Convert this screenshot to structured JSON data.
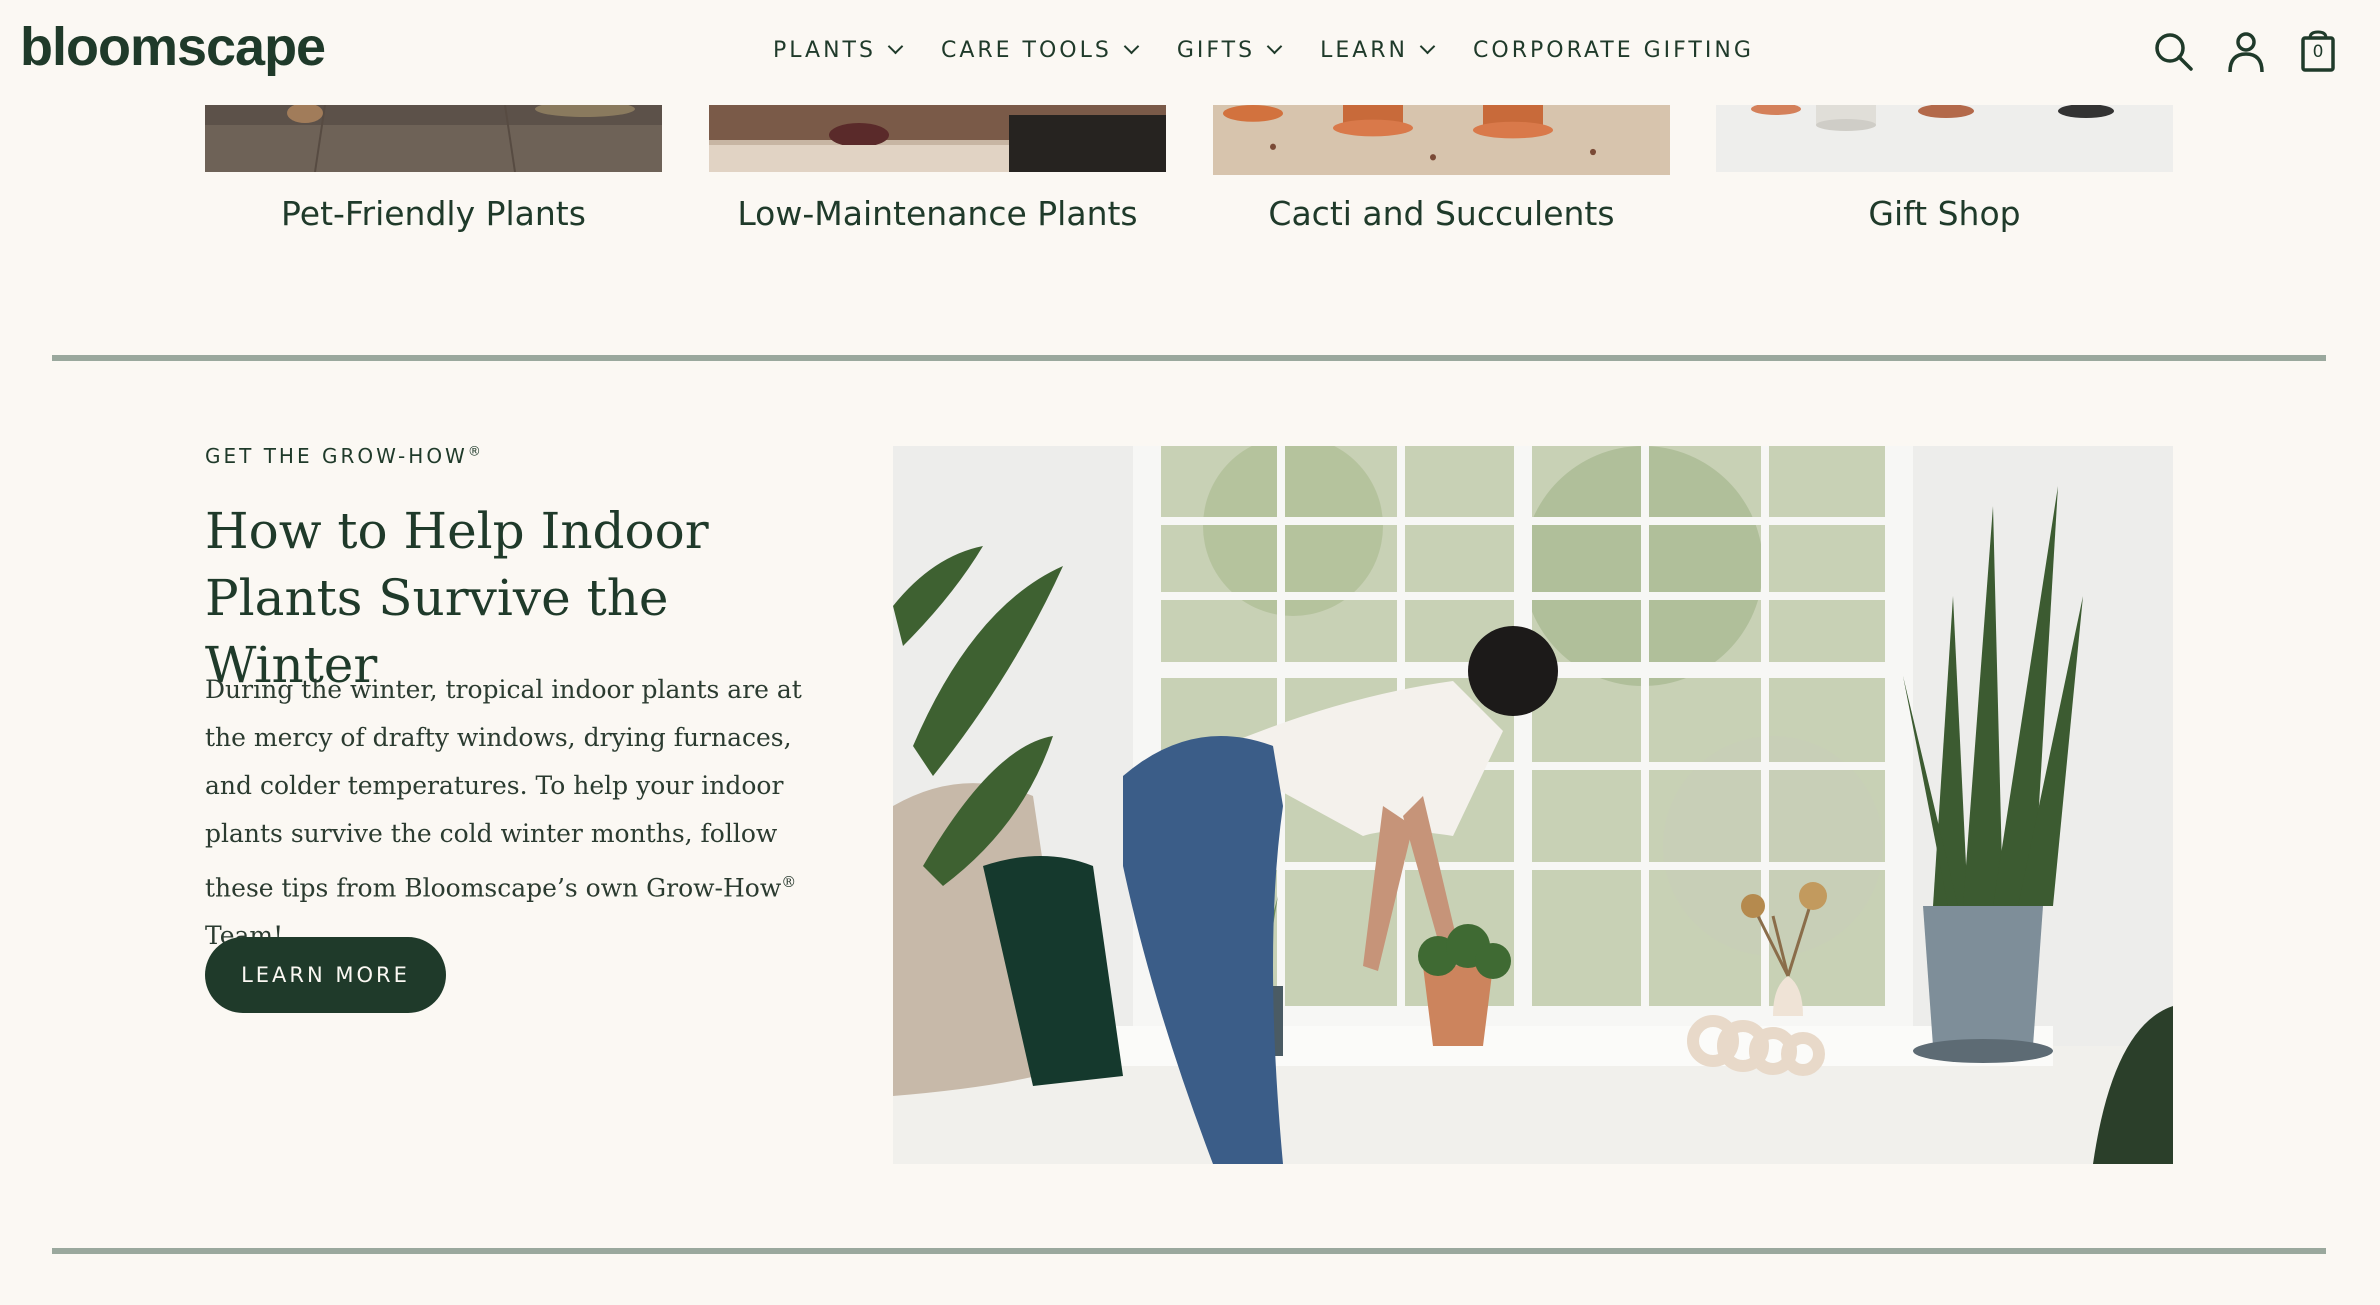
{
  "brand": {
    "logo": "bloomscape"
  },
  "nav": {
    "items": [
      {
        "label": "PLANTS",
        "has_dropdown": true
      },
      {
        "label": "CARE TOOLS",
        "has_dropdown": true
      },
      {
        "label": "GIFTS",
        "has_dropdown": true
      },
      {
        "label": "LEARN",
        "has_dropdown": true
      },
      {
        "label": "CORPORATE GIFTING",
        "has_dropdown": false
      }
    ]
  },
  "header_icons": {
    "search": "search-icon",
    "account": "user-icon",
    "cart": "cart-icon",
    "cart_count": "0"
  },
  "categories": [
    {
      "label": "Pet-Friendly Plants"
    },
    {
      "label": "Low-Maintenance Plants"
    },
    {
      "label": "Cacti and Succulents"
    },
    {
      "label": "Gift Shop"
    }
  ],
  "article": {
    "eyebrow": "GET THE GROW-HOW",
    "eyebrow_mark": "®",
    "headline": "How to Help Indoor Plants Survive the Winter",
    "body_before": "During the winter, tropical indoor plants are at the mercy of drafty windows, drying furnaces, and colder temperatures. To help your indoor plants survive the cold winter months, follow these tips from Bloomscape’s own Grow-How",
    "body_mark": "®",
    "body_after": " Team!",
    "cta": "LEARN MORE"
  },
  "colors": {
    "brand_green": "#1f3a2a",
    "background": "#fbf8f3",
    "divider": "#9aa89d"
  }
}
